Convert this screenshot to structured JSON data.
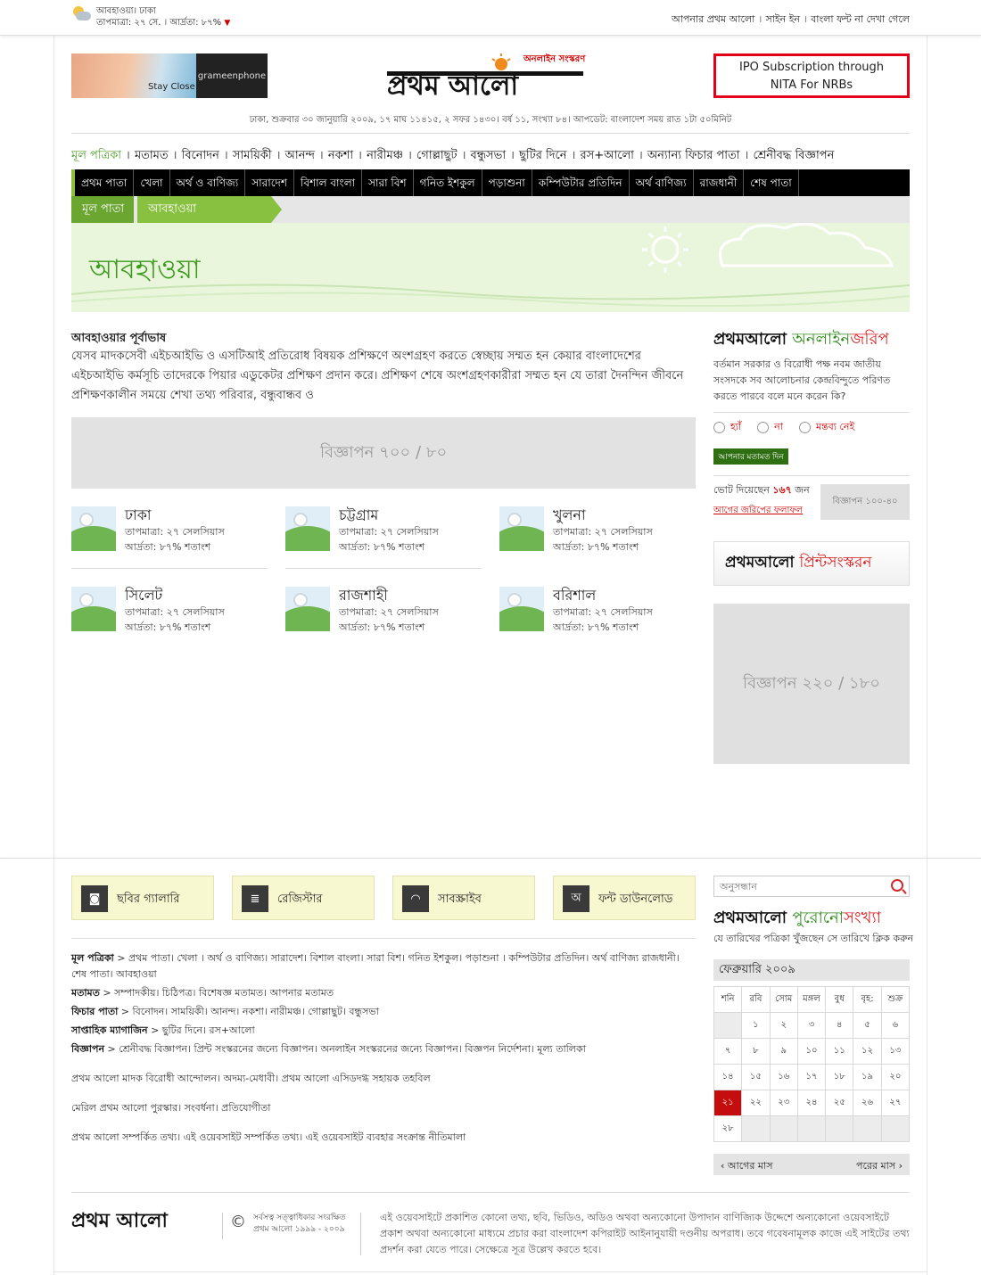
{
  "topbar": {
    "weather_city": "আবহাওয়া। ঢাকা",
    "weather_detail": "তাপমাত্রা: ২৭ সে. । আর্দ্রতা: ৮৭%",
    "links": [
      "আপনার প্রথম আলো",
      "সাইন ইন",
      "বাংলা ফন্ট না দেখা গেলে"
    ]
  },
  "header": {
    "ad_left_text": "Stay Close",
    "ad_left_brand": "grameenphone",
    "logo_text": "প্রথম আলো",
    "logo_tag": "অনলাইন সংস্করণ",
    "ipo_line1": "IPO Subscription through",
    "ipo_line2": "NITA For NRBs",
    "dateline": "ঢাকা, শুক্রবার ৩০ জানুয়ারি ২০০৯, ১৭ মাঘ ১১৪১৫, ২ সফর ১৪৩০। বর্ষ ১১, সংখ্যা ৮৪। আপডেট: বাংলাদেশ সময় রাত ১টা ৫০মিনিট"
  },
  "mainnav": [
    "মূল পত্রিকা",
    "মতামত",
    "বিনোদন",
    "সাময়িকী",
    "আনন্দ",
    "নকশা",
    "নারীমঞ্চ",
    "গোল্লাছুট",
    "বন্ধুসভা",
    "ছুটির দিনে",
    "রস+আলো",
    "অন্যান্য ফিচার পাতা",
    "শ্রেনীবদ্ধ বিজ্ঞাপন"
  ],
  "subnav": [
    "প্রথম পাতা",
    "খেলা",
    "অর্থ ও বাণিজ্য",
    "সারাদেশ",
    "বিশাল বাংলা",
    "সারা বিশ",
    "গনিত ইশকুল",
    "পড়াশুনা",
    "কম্পিউটার প্রতিদিন",
    "অর্থ বাণিজ্য",
    "রাজধানী",
    "শেষ পাতা"
  ],
  "breadcrumb": {
    "home": "মূল পাতা",
    "current": "আবহাওয়া"
  },
  "hero_title": "আবহাওয়া",
  "forecast": {
    "title": "আবহাওয়ার পূর্বাভাষ",
    "body": "যেসব মাদকসেবী এইচআইভি ও এসটিআই প্রতিরোধ বিষয়ক প্রশিক্ষণে অংশগ্রহণ করতে স্বেচ্ছায় সম্মত হন কেয়ার বাংলাদেশের এইচআইভি কর্মসূচি তাদেরকে পিয়ার এডুকেটর প্রশিক্ষণ প্রদান করে। প্রশিক্ষণ শেষে অংশগ্রহণকারীরা সম্মত হন যে তারা দৈনন্দিন জীবনে প্রশিক্ষণকালীন সময়ে শেখা তথ্য পরিবার, বন্ধুবান্ধব ও"
  },
  "ad_700": "বিজ্ঞাপন ৭০০ / ৮০",
  "cities": [
    {
      "name": "ঢাকা",
      "temp": "তাপমাত্রা: ২৭ সেলসিয়াস",
      "humidity": "আর্দ্রতা: ৮৭% শতাংশ"
    },
    {
      "name": "চট্টগ্রাম",
      "temp": "তাপমাত্রা: ২৭ সেলসিয়াস",
      "humidity": "আর্দ্রতা: ৮৭% শতাংশ"
    },
    {
      "name": "খুলনা",
      "temp": "তাপমাত্রা: ২৭ সেলসিয়াস",
      "humidity": "আর্দ্রতা: ৮৭% শতাংশ"
    },
    {
      "name": "সিলেট",
      "temp": "তাপমাত্রা: ২৭ সেলসিয়াস",
      "humidity": "আর্দ্রতা: ৮৭% শতাংশ"
    },
    {
      "name": "রাজশাহী",
      "temp": "তাপমাত্রা: ২৭ সেলসিয়াস",
      "humidity": "আর্দ্রতা: ৮৭% শতাংশ"
    },
    {
      "name": "বরিশাল",
      "temp": "তাপমাত্রা: ২৭ সেলসিয়াস",
      "humidity": "আর্দ্রতা: ৮৭% শতাংশ"
    }
  ],
  "poll": {
    "logo_a": "প্রথমআলো",
    "logo_b": "অনলাইন",
    "logo_c": "জরিপ",
    "question": "বর্তমান সরকার ও বিরোধী পক্ষ নবম জাতীয় সংসদকে সব আলোচনার কেন্দ্রবিন্দুতে পরিণত করতে পারবে বলে মনে করেন কি?",
    "options": [
      "হ্যাঁ",
      "না",
      "মন্তব্য নেই"
    ],
    "submit": "আপনার মতামত দিন",
    "votes_prefix": "ভোট দিয়েছেন",
    "votes_count": "১৬৭",
    "votes_suffix": "জন",
    "previous_results": "আগের জরিপের ফলাফল",
    "ad_small": "বিজ্ঞাপন ১০০-৪০"
  },
  "print_edition": {
    "a": "প্রথমআলো",
    "b": "প্রিন্টসংস্করন"
  },
  "ad_220": "বিজ্ঞাপন ২২০ / ১৮০",
  "footer": {
    "buttons": [
      {
        "label": "ছবির গ্যালারি",
        "icon": "camera-icon",
        "glyph": "◙"
      },
      {
        "label": "রেজিস্টার",
        "icon": "document-icon",
        "glyph": "≣"
      },
      {
        "label": "সাবস্ক্রাইব",
        "icon": "rss-icon",
        "glyph": "◠"
      },
      {
        "label": "ফন্ট ডাউনলোড",
        "icon": "font-icon",
        "glyph": "অ"
      }
    ],
    "sitemap": [
      {
        "head": "মূল পত্রিকা",
        "items": "প্রথম পাতা। খেলা । অর্থ ও বাণিজ্য। সারাদেশ। বিশাল বাংলা। সারা বিশ। গনিত ইশকুল। পড়াশুনা । কম্পিউটার প্রতিদিন। অর্থ বাণিজ্য রাজধানী। শেষ পাতা। আবহাওয়া"
      },
      {
        "head": "মতামত",
        "items": "সম্পাদকীয়। চিঠিপত্র। বিশেষজ্ঞ মতামত। আপনার মতামত"
      },
      {
        "head": "ফিচার পাতা",
        "items": "বিনোদন। সাময়িকী। আনন্দ। নকশা। নারীমঞ্চ। গোল্লাছুট। বন্ধুসভা"
      },
      {
        "head": "সাপ্তাহিক ম্যাগাজিন",
        "items": "ছুটির দিনে। রস+আলো"
      },
      {
        "head": "বিজ্ঞাপন",
        "items": "শ্রেনীবদ্ধ বিজ্ঞাপন। প্রিন্ট সংস্করনের জন্যে বিজ্ঞাপন। অনলাইন সংস্করনের জন্যে বিজ্ঞাপন। বিজ্ঞপন নির্দেশনা। মূল্য তালিকা"
      }
    ],
    "extra_line1": "প্রথম আলো মাদক বিরোধী আন্দোলন। অদম্য-মেধাবী। প্রথম আলো এসিডদগ্ধ সহায়ক তহবিল",
    "extra_line2": "মেরিল প্রথম আলো পুরস্কার। সংবর্ধনা। প্রতিযোগীতা",
    "extra_line3": "প্রথম আলো সম্পর্কিত তথ্য। এই ওয়েবসাইট সম্পর্কিত তথ্য। এই ওয়েবসাইট ব্যবহার সংক্রান্ত নীতিমালা",
    "search_placeholder": "অনুসন্ধান",
    "archive_a": "প্রথমআলো",
    "archive_b": "পুরোনো",
    "archive_c": "সংখ্যা",
    "archive_sub": "যে তারিখের পত্রিকা খুঁজছেন সে তারিখে ক্লিক করুন",
    "calendar_month": "ফেব্রুয়ারি ২০০৯",
    "calendar_days": [
      "শনি",
      "রবি",
      "সোম",
      "মঙ্গল",
      "বুধ",
      "বৃহ:",
      "শুক্র"
    ],
    "calendar_weeks": [
      [
        "",
        "১",
        "২",
        "৩",
        "৪",
        "৫",
        "৬"
      ],
      [
        "৭",
        "৮",
        "৯",
        "১০",
        "১১",
        "১২",
        "১৩"
      ],
      [
        "১৪",
        "১৫",
        "১৬",
        "১৭",
        "১৮",
        "১৯",
        "২০"
      ],
      [
        "২১",
        "২২",
        "২৩",
        "২৪",
        "২৫",
        "২৬",
        "২৭"
      ],
      [
        "২৮",
        "",
        "",
        "",
        "",
        "",
        ""
      ]
    ],
    "calendar_today": "২১",
    "prev_month": "আগের মাস",
    "next_month": "পরের মাস",
    "logo": "প্রথম আলো",
    "copyright_line1": "সর্বসত্ব সত্ত্বাধিকার সংরক্ষিত",
    "copyright_line2": "প্রথম আলো ১৯৯৯ - ২০০৯",
    "disclaimer": "এই ওয়েবসাইটে প্রকাশিত কোনো তথ্য, ছবি, ভিডিও, অডিও অথবা অন্যকোনো উপাদান বাণিজ্যিক উদ্দেশে অন্যকোনো ওয়েবসাইটে প্রকাশ অথবা অন্যকোনো মাধ্যমে প্রচার করা বাংলাদেশ কপিরাইট আইনানুযায়ী দণ্ডনীয় অপরাধ। তবে গবেষনামূলক কাজে এই সাইটের তথ্য প্রদর্শন করা যেতে পারে। সেক্ষেত্রে সূত্র উল্লেখ করতে হবে।"
  },
  "colors": {
    "brand_green": "#4c9a2a",
    "brand_red": "#e2001a",
    "nav_black": "#000000"
  }
}
